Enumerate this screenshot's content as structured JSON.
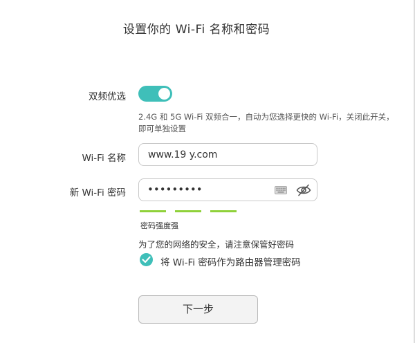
{
  "page": {
    "title": "设置你的 Wi-Fi 名称和密码"
  },
  "dual_band": {
    "label": "双频优选",
    "enabled": true,
    "description": "2.4G 和 5G Wi-Fi 双频合一，自动为您选择更快的 Wi-Fi，关闭此开关，即可单独设置"
  },
  "wifi_name": {
    "label": "Wi-Fi 名称",
    "value": "www.19 y.com"
  },
  "wifi_password": {
    "label": "新 Wi-Fi 密码",
    "value": "•••••••••",
    "keyboard_icon": "keyboard-icon",
    "visibility_icon": "eye-hidden-icon"
  },
  "strength": {
    "bars": 3,
    "color": "#8fd13a",
    "label": "密码强度强"
  },
  "security_note": "为了您的网络的安全，请注意保管好密码",
  "use_as_admin": {
    "checked": true,
    "label": "将 Wi-Fi 密码作为路由器管理密码"
  },
  "next_button": {
    "label": "下一步"
  },
  "colors": {
    "accent": "#3fbfb9",
    "strength": "#8fd13a"
  }
}
